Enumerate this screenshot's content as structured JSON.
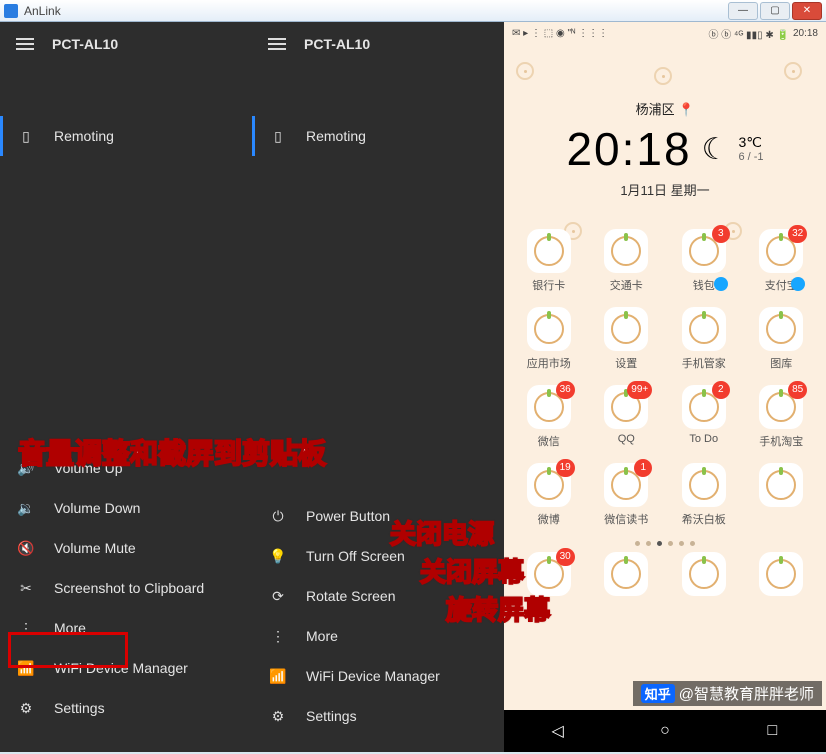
{
  "window": {
    "title": "AnLink",
    "device_name": "PCT-AL10"
  },
  "left_sidebar": {
    "remoting": "Remoting",
    "volume_up": "Volume Up",
    "volume_down": "Volume Down",
    "volume_mute": "Volume Mute",
    "screenshot": "Screenshot to Clipboard",
    "more": "More",
    "wifi_mgr": "WiFi Device Manager",
    "settings": "Settings"
  },
  "right_sidebar": {
    "remoting": "Remoting",
    "power_button": "Power Button",
    "turn_off": "Turn Off Screen",
    "rotate": "Rotate Screen",
    "more": "More",
    "wifi_mgr": "WiFi Device Manager",
    "settings": "Settings"
  },
  "annotations": {
    "a1": "音量调整和截屏到剪贴板",
    "a2": "关闭电源",
    "a3": "关闭屏幕",
    "a4": "旋转屏幕"
  },
  "phone": {
    "status_left": "✉ ▸ ⋮ ⬚ ◉ \"ᴺ ⋮⋮⋮",
    "status_icons": "ᴺ ⊙ ⚙ ● ⋯",
    "status_signal": "ⓑ ⓑ ⁴ᴳ ▮▮▯ ✱ 🔋",
    "status_time": "20:18",
    "location": "杨浦区 📍",
    "time": "20:18",
    "moon": "☾",
    "temp_hi": "3℃",
    "temp_lo": "6 / -1",
    "date": "1月11日 星期一",
    "apps": [
      [
        {
          "label": "银行卡"
        },
        {
          "label": "交通卡"
        },
        {
          "label": "钱包",
          "badge": "3",
          "mark": true
        },
        {
          "label": "支付宝",
          "badge": "32",
          "mark": true
        }
      ],
      [
        {
          "label": "应用市场"
        },
        {
          "label": "设置"
        },
        {
          "label": "手机管家"
        },
        {
          "label": "图库"
        }
      ],
      [
        {
          "label": "微信",
          "badge": "36"
        },
        {
          "label": "QQ",
          "badge": "99+"
        },
        {
          "label": "To Do",
          "badge": "2"
        },
        {
          "label": "手机淘宝",
          "badge": "85"
        }
      ],
      [
        {
          "label": "微博",
          "badge": "19"
        },
        {
          "label": "微信读书",
          "badge": "1"
        },
        {
          "label": "希沃白板"
        },
        {
          "label": ""
        }
      ],
      [
        {
          "label": "",
          "badge": "30"
        },
        {
          "label": ""
        },
        {
          "label": ""
        },
        {
          "label": ""
        }
      ]
    ],
    "watermark_logo": "知乎",
    "watermark": "@智慧教育胖胖老师"
  }
}
